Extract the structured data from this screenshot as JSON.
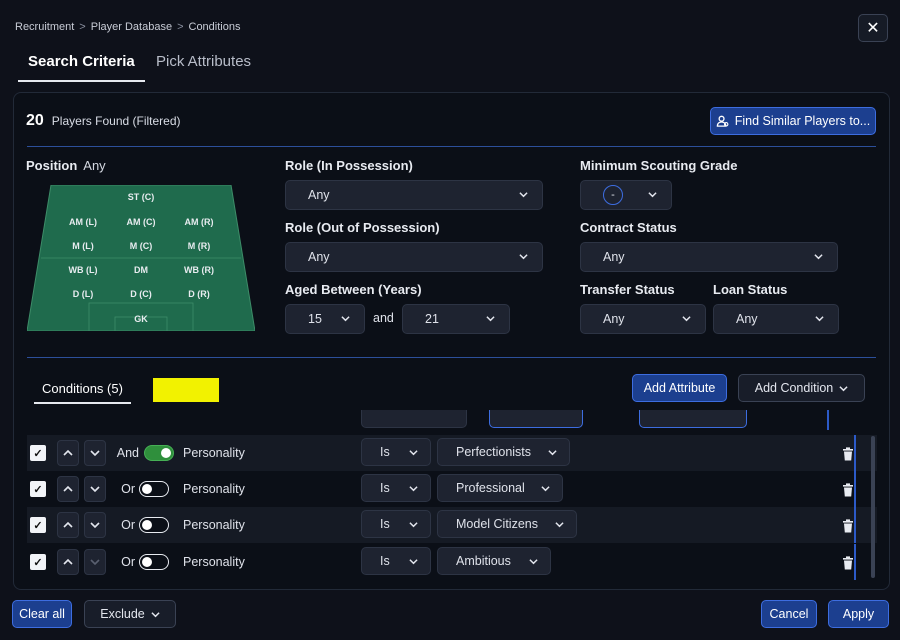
{
  "breadcrumb": [
    "Recruitment",
    "Player Database",
    "Conditions"
  ],
  "close_label": "✕",
  "tabs": {
    "active": "Search Criteria",
    "inactive": "Pick Attributes"
  },
  "found": {
    "count": "20",
    "label": "Players Found (Filtered)"
  },
  "find_similar_label": "Find Similar Players to...",
  "position": {
    "label": "Position",
    "value": "Any",
    "slots": [
      "ST (C)",
      "AM (L)",
      "AM (C)",
      "AM (R)",
      "M (L)",
      "M (C)",
      "M (R)",
      "WB (L)",
      "DM",
      "WB (R)",
      "D (L)",
      "D (C)",
      "D (R)",
      "GK"
    ]
  },
  "role_in": {
    "label": "Role (In Possession)",
    "value": "Any"
  },
  "role_out": {
    "label": "Role (Out of Possession)",
    "value": "Any"
  },
  "aged": {
    "label": "Aged Between (Years)",
    "min": "15",
    "and": "and",
    "max": "21"
  },
  "min_grade": {
    "label": "Minimum Scouting Grade",
    "value": "-"
  },
  "contract": {
    "label": "Contract Status",
    "value": "Any"
  },
  "transfer": {
    "label": "Transfer Status",
    "value": "Any"
  },
  "loan": {
    "label": "Loan Status",
    "value": "Any"
  },
  "conditions_title": "Conditions (5)",
  "add_attribute_label": "Add Attribute",
  "add_condition_label": "Add Condition",
  "rows": [
    {
      "logic": "And",
      "toggle": true,
      "attribute": "Personality",
      "op": "Is",
      "value": "Perfectionists"
    },
    {
      "logic": "Or",
      "toggle": false,
      "attribute": "Personality",
      "op": "Is",
      "value": "Professional"
    },
    {
      "logic": "Or",
      "toggle": false,
      "attribute": "Personality",
      "op": "Is",
      "value": "Model Citizens"
    },
    {
      "logic": "Or",
      "toggle": false,
      "attribute": "Personality",
      "op": "Is",
      "value": "Ambitious"
    }
  ],
  "footer": {
    "clear_all": "Clear all",
    "exclude": "Exclude",
    "cancel": "Cancel",
    "apply": "Apply"
  },
  "colors": {
    "accent": "#3d6de0",
    "highlight": "#f2f200",
    "pitch": "#1f6b4d",
    "toggle_on": "#2f8f3c"
  }
}
